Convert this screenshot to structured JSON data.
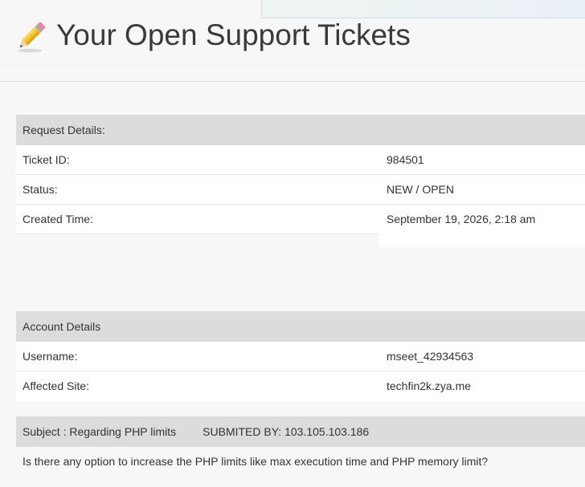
{
  "header": {
    "title": "Your Open Support Tickets",
    "icon": "pencil-icon"
  },
  "request_details": {
    "header": "Request Details:",
    "rows": [
      {
        "label": "Ticket ID:",
        "value": "984501"
      },
      {
        "label": "Status:",
        "value": "NEW / OPEN"
      },
      {
        "label": "Created Time:",
        "value": "September 19, 2026, 2:18 am"
      }
    ]
  },
  "account_details": {
    "header": "Account Details",
    "rows": [
      {
        "label": "Username:",
        "value": "mseet_42934563"
      },
      {
        "label": "Affected Site:",
        "value": "techfin2k.zya.me"
      }
    ]
  },
  "subject": {
    "subject_text": "Subject : Regarding PHP limits",
    "submitted_by": "SUBMITED BY: 103.105.103.186",
    "message": "Is there any option to increase the PHP limits like max execution time and PHP memory limit?"
  }
}
